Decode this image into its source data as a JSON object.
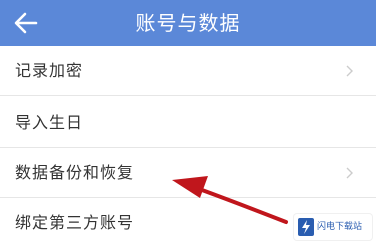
{
  "header": {
    "title": "账号与数据",
    "back_icon": "back-arrow-icon",
    "background": "#5b88d8"
  },
  "menu": {
    "items": [
      {
        "label": "记录加密",
        "has_chevron": true
      },
      {
        "label": "导入生日",
        "has_chevron": false
      },
      {
        "label": "数据备份和恢复",
        "has_chevron": true
      },
      {
        "label": "绑定第三方账号",
        "has_chevron": false
      }
    ]
  },
  "annotation": {
    "icon": "red-pointer-arrow-icon",
    "color": "#c0161c"
  },
  "watermark": {
    "text": "闪电下载站"
  }
}
